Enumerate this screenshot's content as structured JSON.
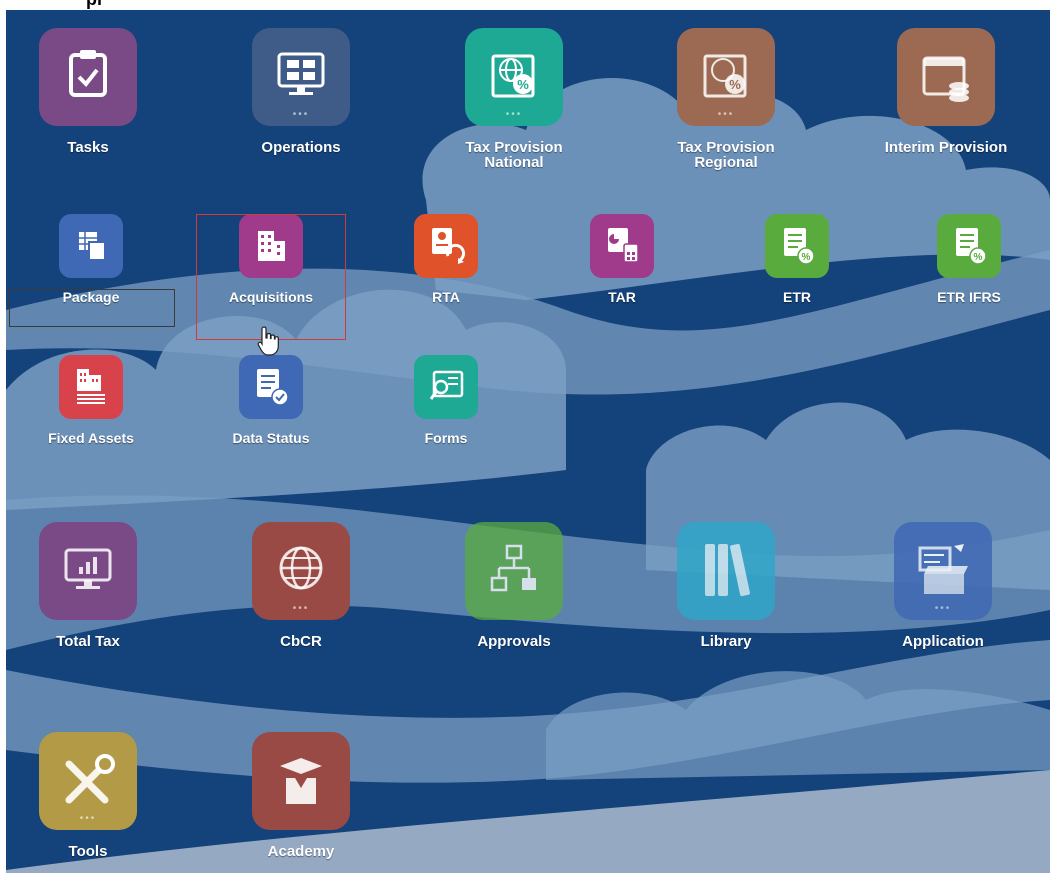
{
  "header": {
    "partial_text": "pr"
  },
  "colors": {
    "background": "#123f73",
    "cloud": "#7b9fc4",
    "selection": "#d23a3a",
    "purple": "#7a4a86",
    "slate": "#3f5c88",
    "teal": "#1ea994",
    "brown": "#9c6a52",
    "magenta": "#a03a8a",
    "orange": "#e0532a",
    "green": "#5aab3e",
    "red": "#d8424a",
    "blue": "#3f68b5",
    "dark_red": "#9a4a44",
    "olive": "#b29a46",
    "cyan": "#2fa6c8"
  },
  "tiles": {
    "tasks": {
      "label": "Tasks",
      "icon": "clipboard-check-icon"
    },
    "operations": {
      "label": "Operations",
      "icon": "monitor-grid-icon"
    },
    "tax_provision_national": {
      "label": "Tax Provision\nNational",
      "icon": "globe-percent-icon"
    },
    "tax_provision_regional": {
      "label": "Tax Provision\nRegional",
      "icon": "map-percent-icon"
    },
    "interim_provision": {
      "label": "Interim Provision",
      "icon": "calendar-coins-icon"
    },
    "package": {
      "label": "Package",
      "icon": "package-grid-icon"
    },
    "acquisitions": {
      "label": "Acquisitions",
      "icon": "building-icon"
    },
    "rta": {
      "label": "RTA",
      "icon": "document-refresh-icon"
    },
    "tar": {
      "label": "TAR",
      "icon": "document-calculator-icon"
    },
    "etr": {
      "label": "ETR",
      "icon": "document-percent-icon"
    },
    "etr_ifrs": {
      "label": "ETR IFRS",
      "icon": "document-percent-icon"
    },
    "fixed_assets": {
      "label": "Fixed Assets",
      "icon": "building-list-icon"
    },
    "data_status": {
      "label": "Data Status",
      "icon": "document-check-icon"
    },
    "forms": {
      "label": "Forms",
      "icon": "form-search-icon"
    },
    "total_tax": {
      "label": "Total Tax",
      "icon": "monitor-chart-icon"
    },
    "cbcr": {
      "label": "CbCR",
      "icon": "globe-icon"
    },
    "approvals": {
      "label": "Approvals",
      "icon": "hierarchy-icon"
    },
    "library": {
      "label": "Library",
      "icon": "books-icon"
    },
    "application": {
      "label": "Application",
      "icon": "box-tools-icon"
    },
    "tools": {
      "label": "Tools",
      "icon": "wrench-screwdriver-icon"
    },
    "academy": {
      "label": "Academy",
      "icon": "graduate-icon"
    }
  }
}
